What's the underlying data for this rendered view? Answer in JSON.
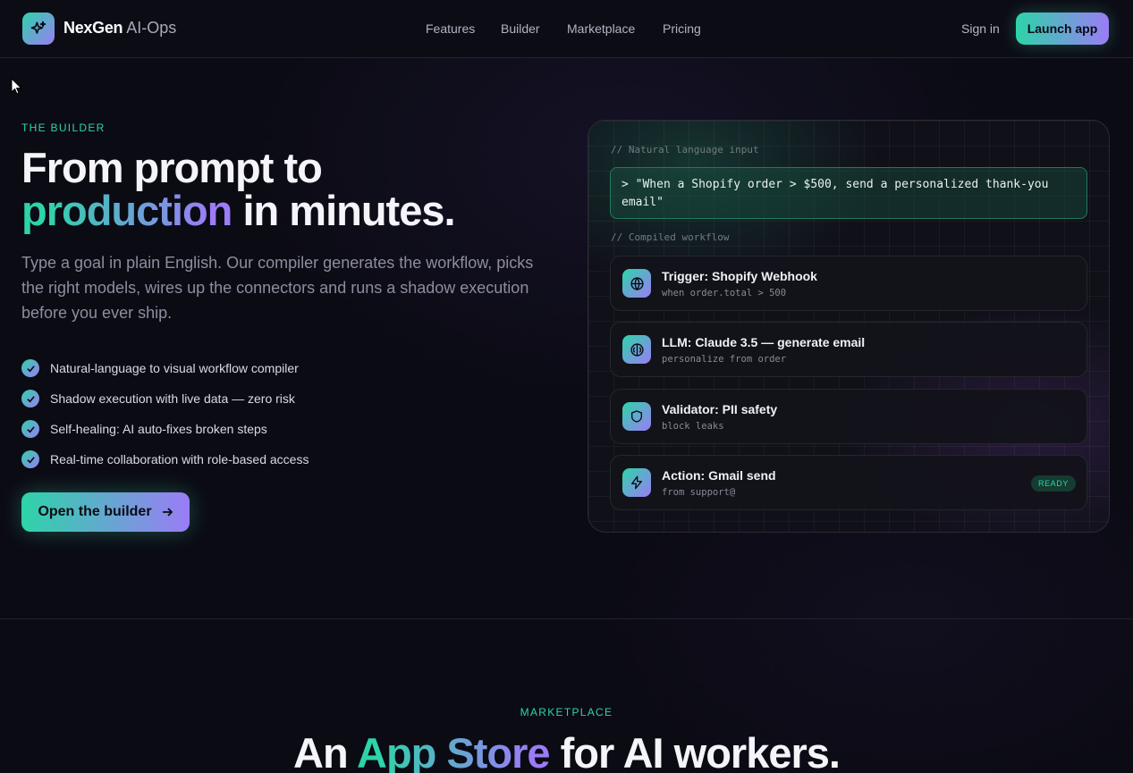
{
  "nav": {
    "brand_bold": "NexGen",
    "brand_rest": "AI-Ops",
    "links": [
      "Features",
      "Builder",
      "Marketplace",
      "Pricing"
    ],
    "signin": "Sign in",
    "launch": "Launch app"
  },
  "hero": {
    "eyebrow": "THE BUILDER",
    "title_line1": "From prompt to",
    "title_highlight": "production",
    "title_rest": "in minutes.",
    "lead": "Type a goal in plain English. Our compiler generates the workflow, picks the right models, wires up the connectors and runs a shadow execution before you ever ship.",
    "features": [
      "Natural-language to visual workflow compiler",
      "Shadow execution with live data — zero risk",
      "Self-healing: AI auto-fixes broken steps",
      "Real-time collaboration with role-based access"
    ],
    "cta": "Open the builder"
  },
  "panel": {
    "input_comment": "// Natural language input",
    "prompt": "> \"When a Shopify order > $500, send a personalized thank-you email\"",
    "workflow_comment": "// Compiled workflow",
    "steps": [
      {
        "title": "Trigger: Shopify Webhook",
        "sub": "when order.total > 500",
        "icon": "globe-icon"
      },
      {
        "title": "LLM: Claude 3.5 — generate email",
        "sub": "personalize from order",
        "icon": "brain-icon"
      },
      {
        "title": "Validator: PII safety",
        "sub": "block leaks",
        "icon": "shield-icon"
      },
      {
        "title": "Action: Gmail send",
        "sub": "from support@",
        "icon": "bolt-icon",
        "badge": "READY"
      }
    ]
  },
  "marketplace": {
    "eyebrow": "MARKETPLACE",
    "title_pre": "An",
    "title_highlight": "App Store",
    "title_post": "for AI workers."
  },
  "colors": {
    "accent_teal": "#2dd4a8",
    "accent_purple": "#9b7cf6",
    "background": "#0b0b14"
  }
}
